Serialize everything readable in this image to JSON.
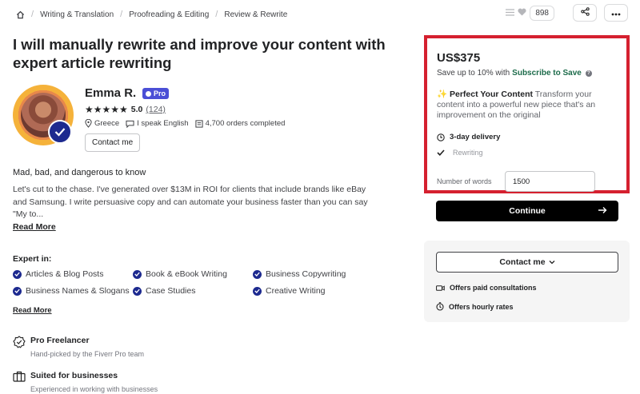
{
  "breadcrumb": {
    "items": [
      "Writing & Translation",
      "Proofreading & Editing",
      "Review & Rewrite"
    ]
  },
  "top": {
    "favorites_count": "898"
  },
  "gig": {
    "title": "I will manually rewrite and improve your content with expert article rewriting"
  },
  "seller": {
    "name": "Emma R.",
    "badge": "Pro",
    "stars": "★★★★★",
    "rating": "5.0",
    "reviews": "(124)",
    "country": "Greece",
    "language": "I speak English",
    "orders": "4,700 orders completed",
    "contact_label": "Contact me"
  },
  "about": {
    "tagline": "Mad, bad, and dangerous to know",
    "description": "Let's cut to the chase. I've generated over $13M in ROI for clients that include brands like eBay and Samsung. I write persuasive copy and can automate your business faster than you can say \"My to...",
    "read_more": "Read More"
  },
  "expertise": {
    "heading": "Expert in:",
    "skills": [
      "Articles & Blog Posts",
      "Book & eBook Writing",
      "Business Copywriting",
      "Business Names & Slogans",
      "Case Studies",
      "Creative Writing"
    ],
    "read_more": "Read More"
  },
  "features": [
    {
      "title": "Pro Freelancer",
      "subtitle": "Hand-picked by the Fiverr Pro team"
    },
    {
      "title": "Suited for businesses",
      "subtitle": "Experienced in working with businesses"
    }
  ],
  "package": {
    "price": "US$375",
    "save_text": "Save up to 10% with",
    "save_link": "Subscribe to Save",
    "name_prefix": "✨",
    "name": "Perfect Your Content",
    "description": "Transform your content into a powerful new piece that's an improvement on the original",
    "delivery": "3-day delivery",
    "includes": "Rewriting",
    "words_label": "Number of words",
    "words_value": "1500",
    "continue_label": "Continue"
  },
  "contact_box": {
    "button_label": "Contact me",
    "paid_consultations": "Offers paid consultations",
    "hourly_rates": "Offers hourly rates"
  },
  "colors": {
    "highlight": "#d5202f",
    "pro": "#4b4fd6",
    "verified": "#1d2a8f",
    "subscribe": "#1c6b4a"
  }
}
